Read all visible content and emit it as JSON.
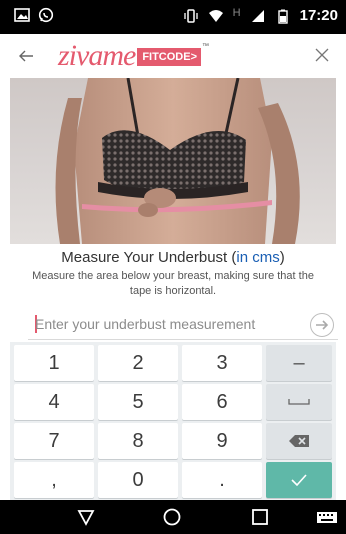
{
  "status_bar": {
    "network_label": "H",
    "time": "17:20"
  },
  "header": {
    "logo_text": "zivame",
    "logo_badge": "FITCODE",
    "logo_arrow": ">",
    "logo_tm": "™"
  },
  "main": {
    "title_prefix": "Measure Your Underbust (",
    "title_unit": "in cms",
    "title_suffix": ")",
    "subtitle": "Measure the area below your breast, making sure that the tape is horizontal.",
    "input_placeholder": "Enter your underbust measurement",
    "input_value": ""
  },
  "keyboard": {
    "rows": [
      [
        "1",
        "2",
        "3",
        "–"
      ],
      [
        "4",
        "5",
        "6",
        "space"
      ],
      [
        "7",
        "8",
        "9",
        "backspace"
      ],
      [
        ",",
        "0",
        ".",
        "done"
      ]
    ]
  },
  "icons": {
    "back": "arrow-left-icon",
    "close": "close-icon",
    "submit": "arrow-right-icon",
    "nav_back": "triangle-back-icon",
    "nav_home": "circle-home-icon",
    "nav_recents": "square-recents-icon",
    "nav_keyboard": "keyboard-icon"
  },
  "colors": {
    "brand": "#e45a6e",
    "accent_blue": "#1a5fb4",
    "done_key": "#5fb8a8"
  }
}
